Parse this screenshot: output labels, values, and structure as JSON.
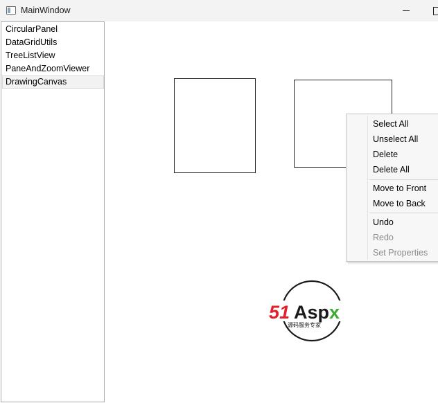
{
  "window": {
    "title": "MainWindow",
    "controls": [
      "minimize-icon",
      "maximize-icon"
    ]
  },
  "sidebar": {
    "items": [
      {
        "label": "CircularPanel",
        "selected": false
      },
      {
        "label": "DataGridUtils",
        "selected": false
      },
      {
        "label": "TreeListView",
        "selected": false
      },
      {
        "label": "PaneAndZoomViewer",
        "selected": false
      },
      {
        "label": "DrawingCanvas",
        "selected": true
      }
    ]
  },
  "canvas": {
    "shapes": [
      "rectangle",
      "rectangle"
    ]
  },
  "context_menu": {
    "items": [
      {
        "label": "Select All",
        "enabled": true
      },
      {
        "label": "Unselect All",
        "enabled": true
      },
      {
        "label": "Delete",
        "enabled": true
      },
      {
        "label": "Delete All",
        "enabled": true
      },
      {
        "label": "Move to Front",
        "enabled": true
      },
      {
        "label": "Move to Back",
        "enabled": true
      },
      {
        "label": "Undo",
        "enabled": true
      },
      {
        "label": "Redo",
        "enabled": false
      },
      {
        "label": "Set Properties",
        "enabled": false
      }
    ]
  },
  "watermark": {
    "brand_number": "51",
    "brand_name": "Aspx",
    "tagline": "源码服务专家",
    "colors": {
      "number": "#e0202a",
      "letters": "#1a1a1a",
      "x": "#3aaa35"
    }
  },
  "colors": {
    "titlebar": "#f3f3f3",
    "border": "#a9a9a9",
    "selected_item": "#f2f2f2",
    "menu_background": "#f7f7f7",
    "disabled_text": "#8a8a8a"
  }
}
